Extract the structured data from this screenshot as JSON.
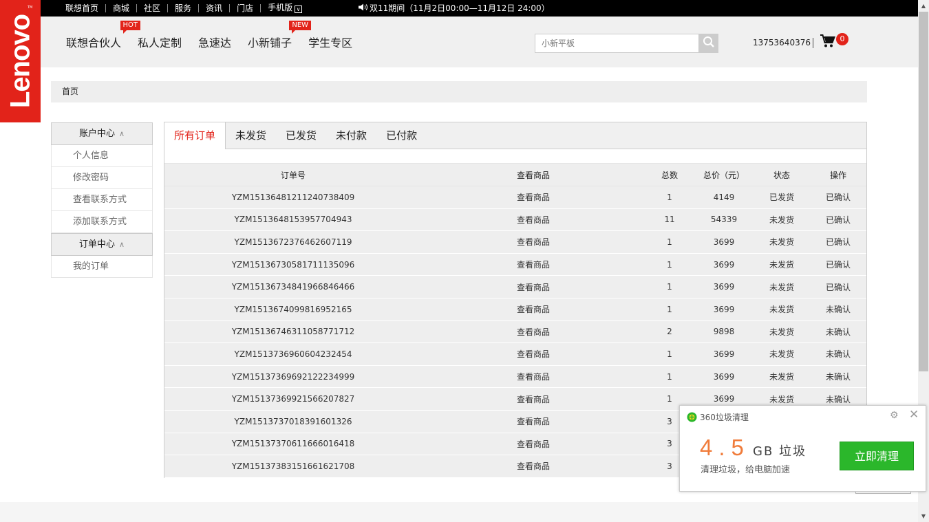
{
  "logo": {
    "text": "Lenovo",
    "mark": "TM"
  },
  "topbar": {
    "links": [
      "联想首页",
      "商城",
      "社区",
      "服务",
      "资讯",
      "门店",
      "手机版"
    ],
    "notice": "双11期间（11月2日00:00—11月12日 24:00）"
  },
  "mainnav": {
    "items": [
      {
        "label": "联想合伙人",
        "badge": "HOT"
      },
      {
        "label": "私人定制",
        "badge": ""
      },
      {
        "label": "急速达",
        "badge": ""
      },
      {
        "label": "小新铺子",
        "badge": "NEW"
      },
      {
        "label": "学生专区",
        "badge": ""
      }
    ]
  },
  "search": {
    "placeholder": "小新平板"
  },
  "user": {
    "phone": "13753640376"
  },
  "cart": {
    "count": "0"
  },
  "breadcrumb": {
    "home": "首页"
  },
  "sidebar": {
    "account": {
      "title": "账户中心",
      "items": [
        "个人信息",
        "修改密码",
        "查看联系方式",
        "添加联系方式"
      ]
    },
    "orders": {
      "title": "订单中心",
      "items": [
        "我的订单"
      ]
    }
  },
  "tabs": [
    "所有订单",
    "未发货",
    "已发货",
    "未付款",
    "已付款"
  ],
  "table": {
    "headers": [
      "订单号",
      "查看商品",
      "总数",
      "总价（元）",
      "状态",
      "操作"
    ],
    "rows": [
      [
        "YZM15136481211240738409",
        "查看商品",
        "1",
        "4149",
        "已发货",
        "已确认"
      ],
      [
        "YZM1513648153957704943",
        "查看商品",
        "11",
        "54339",
        "未发货",
        "已确认"
      ],
      [
        "YZM1513672376462607119",
        "查看商品",
        "1",
        "3699",
        "未发货",
        "已确认"
      ],
      [
        "YZM15136730581711135096",
        "查看商品",
        "1",
        "3699",
        "未发货",
        "已确认"
      ],
      [
        "YZM15136734841966846466",
        "查看商品",
        "1",
        "3699",
        "未发货",
        "已确认"
      ],
      [
        "YZM1513674099816952165",
        "查看商品",
        "1",
        "3699",
        "未发货",
        "未确认"
      ],
      [
        "YZM15136746311058771712",
        "查看商品",
        "2",
        "9898",
        "未发货",
        "未确认"
      ],
      [
        "YZM1513736960604232454",
        "查看商品",
        "1",
        "3699",
        "未发货",
        "未确认"
      ],
      [
        "YZM15137369692122234999",
        "查看商品",
        "1",
        "3699",
        "未发货",
        "未确认"
      ],
      [
        "YZM15137369921566207827",
        "查看商品",
        "1",
        "3699",
        "未发货",
        "未确认"
      ],
      [
        "YZM1513737018391601326",
        "查看商品",
        "3",
        "",
        "",
        ""
      ],
      [
        "YZM15137370611666016418",
        "查看商品",
        "3",
        "",
        "",
        ""
      ],
      [
        "YZM15137383151661621708",
        "查看商品",
        "3",
        "",
        "",
        ""
      ]
    ]
  },
  "popup": {
    "title": "360垃圾清理",
    "size": "4.5",
    "unit": "GB 垃圾",
    "sub": "清理垃圾，给电脑加速",
    "button": "立即清理"
  },
  "colors": {
    "brand": "#e2231a",
    "accent_orange": "#f07c3b",
    "clean_green": "#2bb72b"
  }
}
